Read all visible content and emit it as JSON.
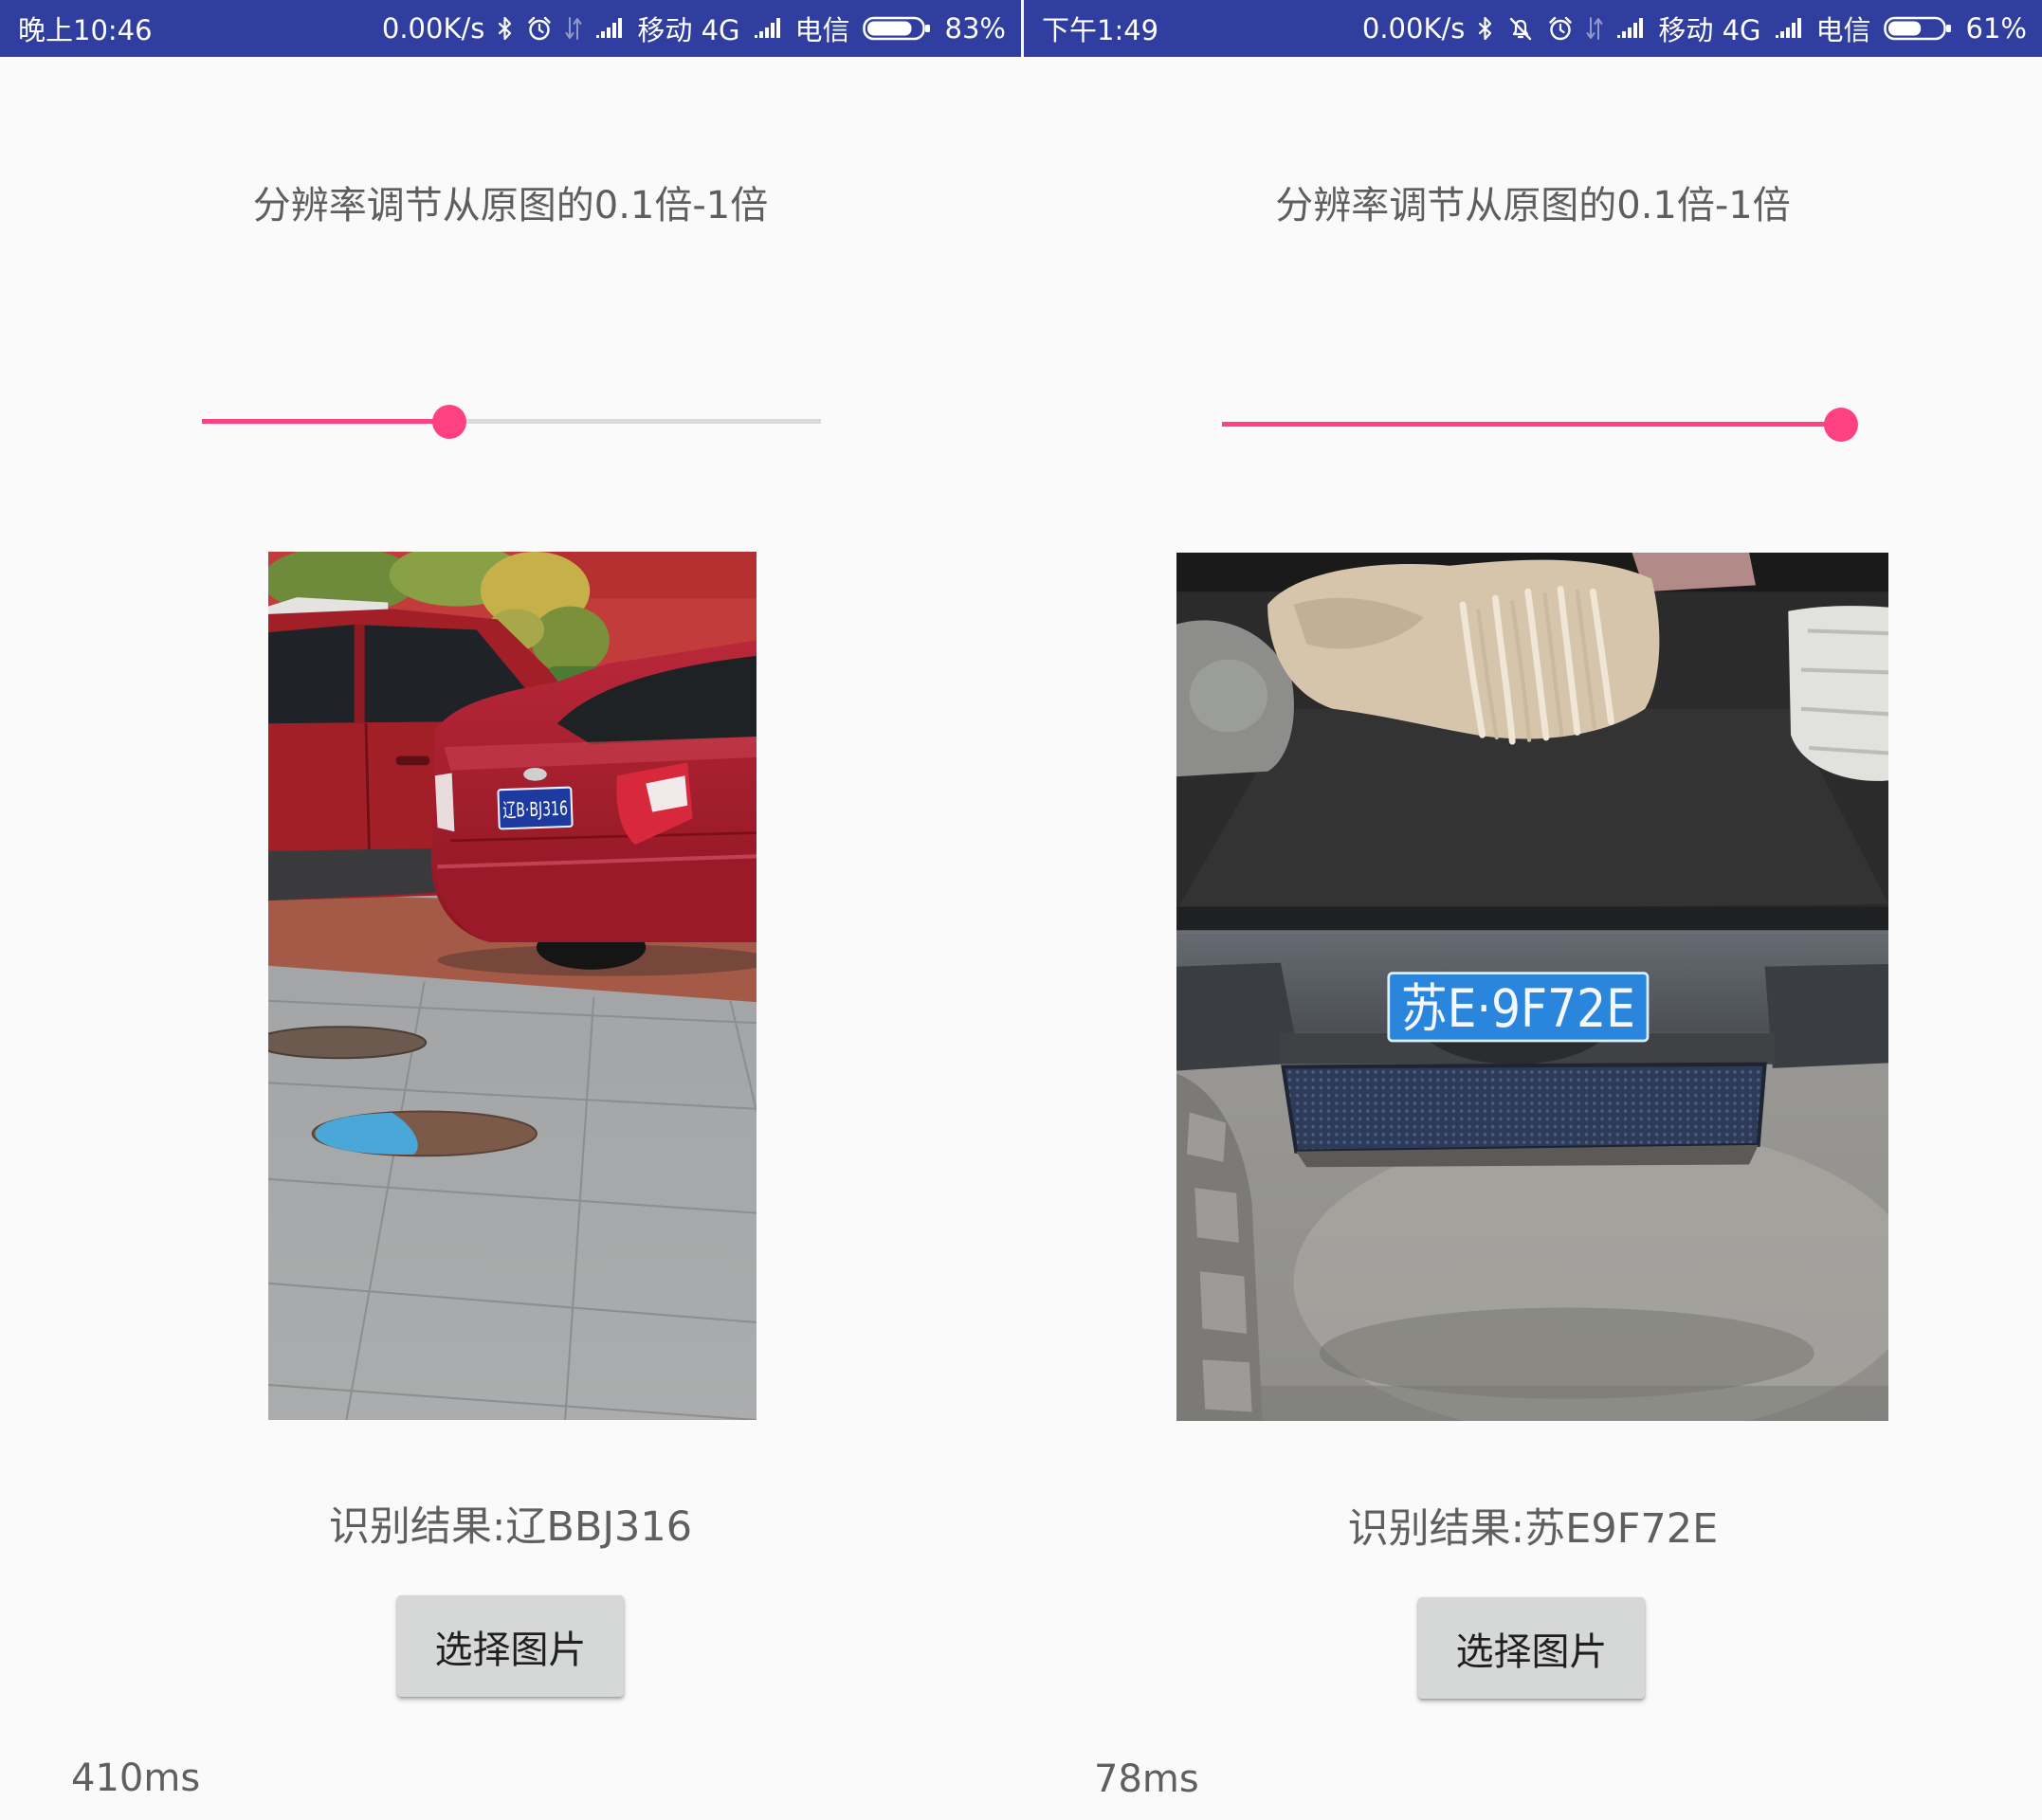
{
  "colors": {
    "status_bar": "#303f9f",
    "accent": "#ff4081",
    "slider_track": "#d9d9d9",
    "button": "#d6d7d7",
    "background": "#fafafa"
  },
  "panels": [
    {
      "status_bar": {
        "time": "晚上10:46",
        "net_speed": "0.00K/s",
        "carrier_1": "移动 4G",
        "carrier_2": "电信",
        "battery_text": "83%",
        "battery_level": 0.83,
        "icons": [
          "bluetooth-icon",
          "alarm-icon",
          "data-arrows-icon",
          "signal-icon",
          "signal-icon",
          "battery-icon"
        ]
      },
      "title": "分辨率调节从原图的0.1倍-1倍",
      "slider": {
        "fraction": 0.4
      },
      "photo": {
        "plate_text": "辽B·BJ316"
      },
      "result": "识别结果:辽BBJ316",
      "button_label": "选择图片",
      "elapsed": "410ms"
    },
    {
      "status_bar": {
        "time": "下午1:49",
        "net_speed": "0.00K/s",
        "carrier_1": "移动 4G",
        "carrier_2": "电信",
        "battery_text": "61%",
        "battery_level": 0.61,
        "icons": [
          "bluetooth-icon",
          "mute-icon",
          "alarm-icon",
          "data-arrows-icon",
          "signal-icon",
          "signal-icon",
          "battery-icon"
        ]
      },
      "title": "分辨率调节从原图的0.1倍-1倍",
      "slider": {
        "fraction": 1.0
      },
      "photo": {
        "plate_text": "苏E·9F72E"
      },
      "result": "识别结果:苏E9F72E",
      "button_label": "选择图片",
      "elapsed": "78ms"
    }
  ]
}
